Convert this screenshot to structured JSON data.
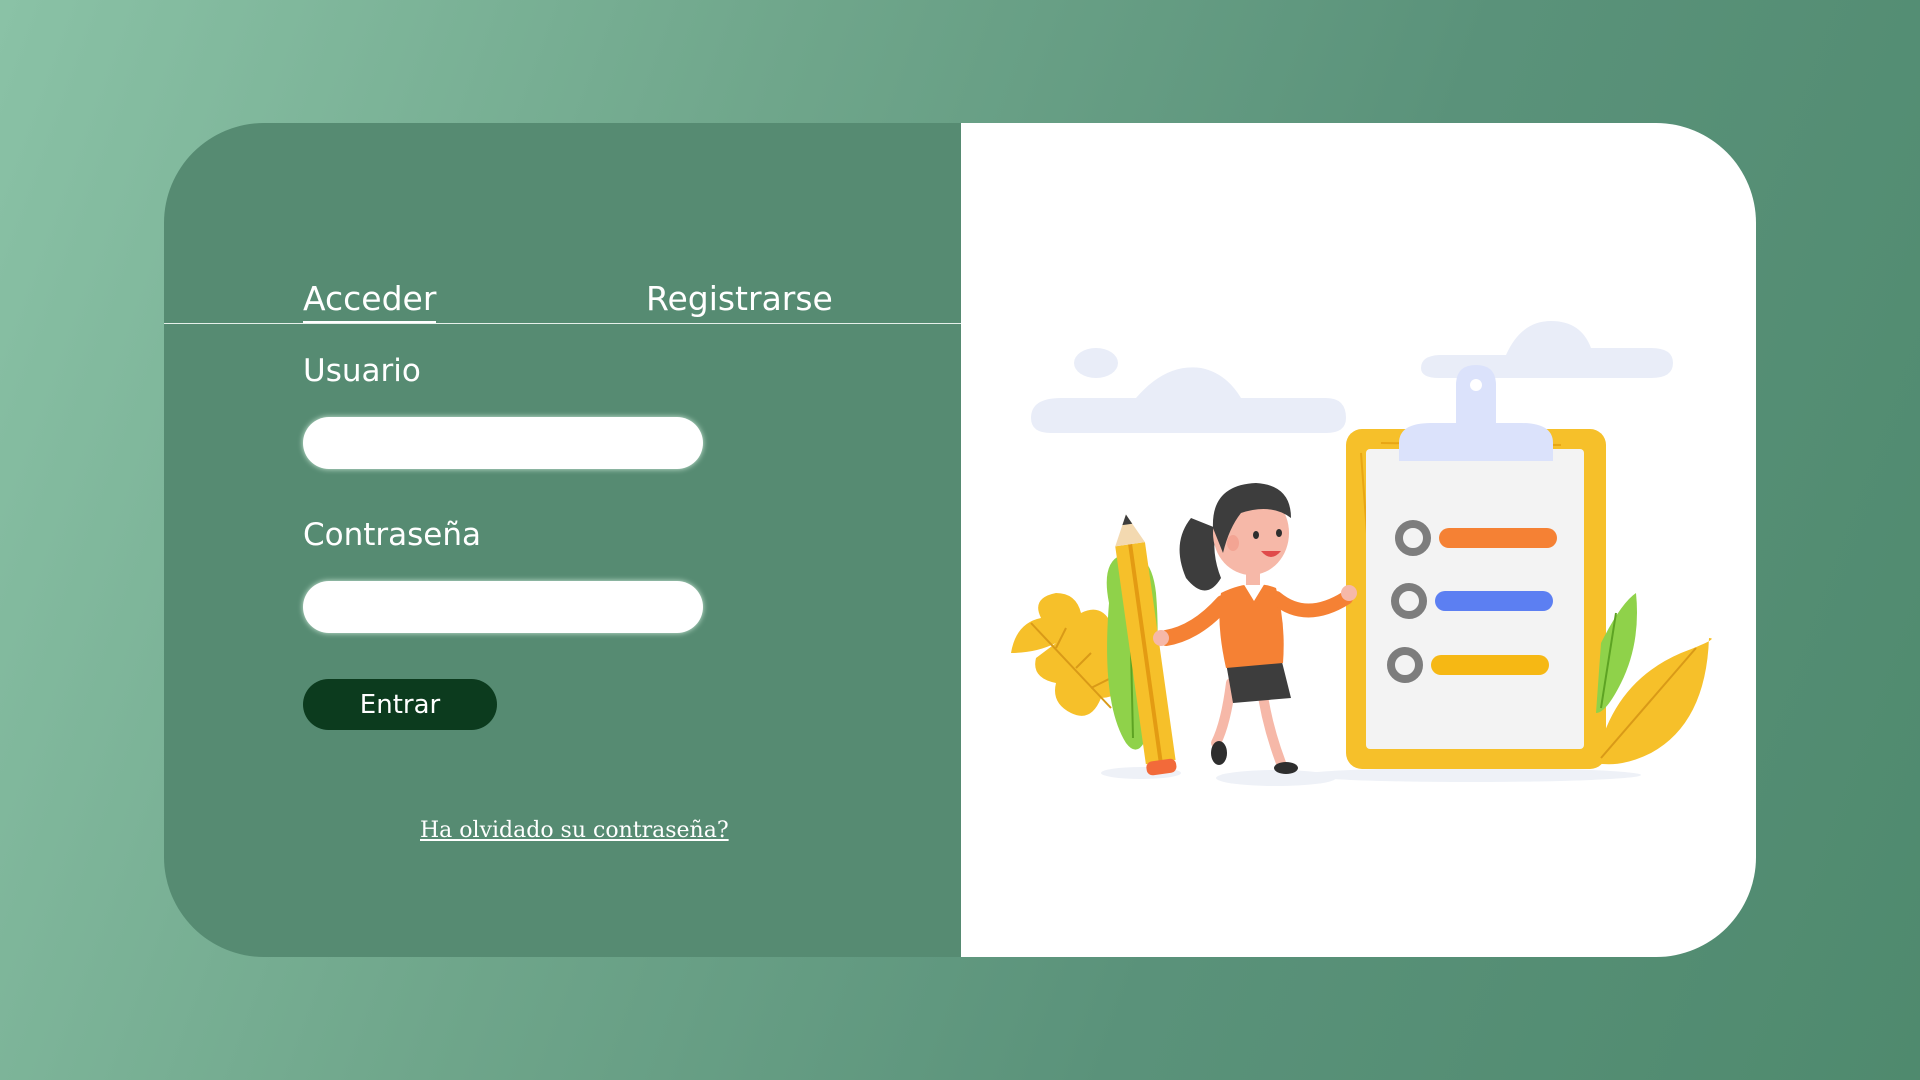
{
  "auth": {
    "tabs": {
      "login_label": "Acceder",
      "register_label": "Registrarse"
    },
    "username": {
      "label": "Usuario",
      "value": "",
      "placeholder": ""
    },
    "password": {
      "label": "Contraseña",
      "value": "",
      "placeholder": ""
    },
    "submit_label": "Entrar",
    "forgot_password_label": "Ha olvidado su contraseña?"
  },
  "illustration": {
    "name": "woman-with-checklist-illustration"
  },
  "colors": {
    "background_gradient_start": "#8ac2a6",
    "background_gradient_end": "#4f8a6e",
    "panel": "#568b72",
    "button": "#0c3b1e",
    "text": "#ffffff"
  }
}
